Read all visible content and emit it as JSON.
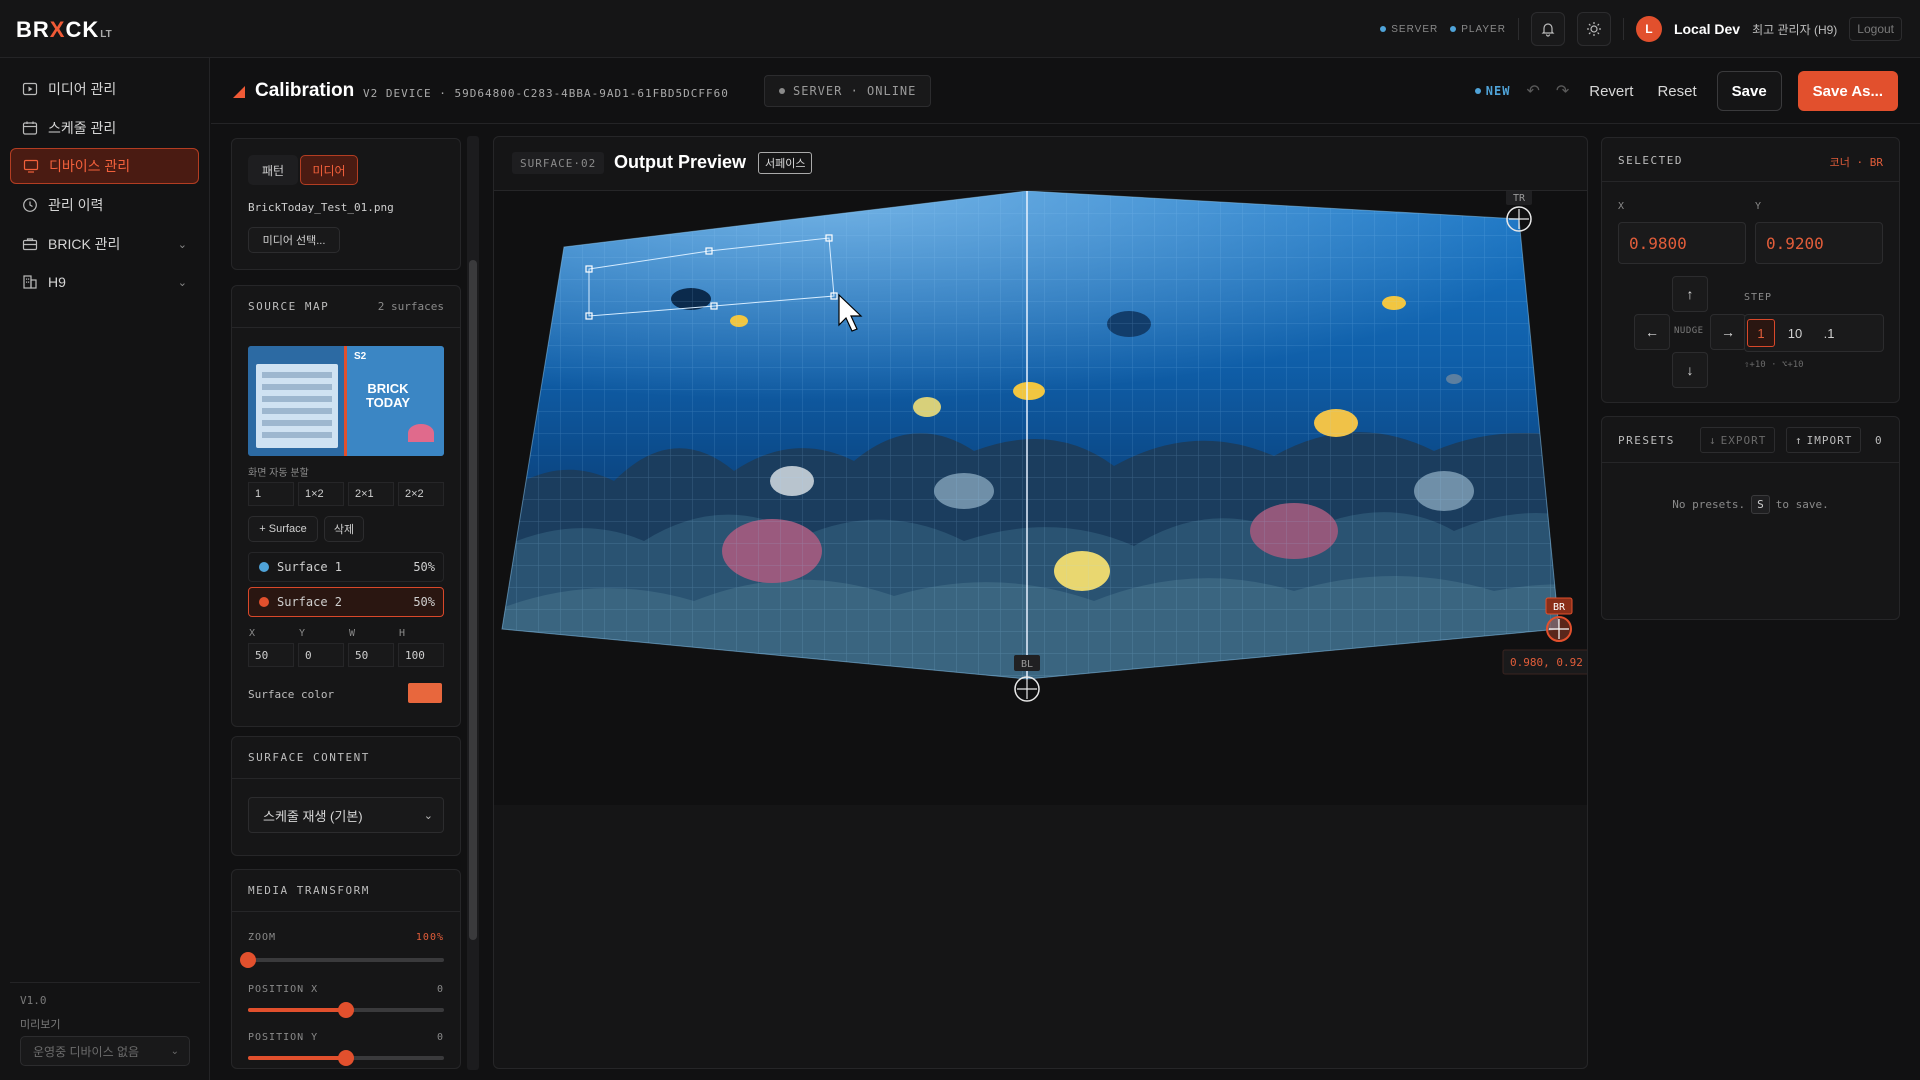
{
  "app": {
    "logo": {
      "pre": "BR",
      "mark": "X",
      "post": "CK",
      "sub": "LT"
    },
    "status": [
      {
        "label": "SERVER"
      },
      {
        "label": "PLAYER"
      }
    ],
    "user": {
      "initial": "L",
      "name": "Local Dev",
      "role": "최고 관리자 (H9)",
      "logout": "Logout"
    },
    "icons": {
      "bell": "bell-icon",
      "theme": "sun-icon"
    }
  },
  "sidebar": {
    "items": [
      {
        "label": "미디어 관리",
        "icon": "media-icon"
      },
      {
        "label": "스케줄 관리",
        "icon": "calendar-icon"
      },
      {
        "label": "디바이스 관리",
        "icon": "monitor-icon",
        "active": true
      },
      {
        "label": "관리 이력",
        "icon": "clock-icon"
      },
      {
        "label": "BRICK 관리",
        "icon": "briefcase-icon",
        "expandable": true
      },
      {
        "label": "H9",
        "icon": "building-icon",
        "expandable": true
      }
    ],
    "version": "V1.0",
    "preview_label": "미리보기",
    "device_select": "운영중 디바이스 없음"
  },
  "header": {
    "title": "Calibration",
    "device": "V2 DEVICE · 59D64800-C283-4BBA-9AD1-61FBD5DCFF60",
    "server_status": "SERVER · ONLINE",
    "new_badge": "NEW",
    "undo": "↶",
    "redo": "↷",
    "revert": "Revert",
    "reset": "Reset",
    "save": "Save",
    "save_as": "Save As..."
  },
  "media_panel": {
    "tabs": [
      "패턴",
      "미디어"
    ],
    "active_tab": "미디어",
    "file_name": "BrickToday_Test_01.png",
    "select_button": "미디어 선택..."
  },
  "source_map": {
    "title": "SOURCE MAP",
    "count": "2 surfaces",
    "thumb_label": "S2",
    "thumb_text": "BRICK TODAY",
    "split_label": "화면 자동 분할",
    "split_options": [
      "1",
      "1×2",
      "2×1",
      "2×2"
    ],
    "add_surface": "+ Surface",
    "delete": "삭제",
    "surfaces": [
      {
        "name": "Surface 1",
        "pct": "50%",
        "color": "#4fa3d8"
      },
      {
        "name": "Surface 2",
        "pct": "50%",
        "color": "#e2502d",
        "selected": true
      }
    ],
    "fields": {
      "labels": [
        "X",
        "Y",
        "W",
        "H"
      ],
      "values": [
        "50",
        "0",
        "50",
        "100"
      ]
    },
    "surface_color_label": "Surface color",
    "surface_color": "#e8673d"
  },
  "surface_content": {
    "title": "SURFACE CONTENT",
    "value": "스케줄 재생 (기본)"
  },
  "media_transform": {
    "title": "MEDIA TRANSFORM",
    "zoom": {
      "label": "ZOOM",
      "value": "100%",
      "fraction": 0
    },
    "position_x": {
      "label": "POSITION X",
      "value": "0",
      "fraction": 0.5
    },
    "position_y": {
      "label": "POSITION Y",
      "value": "0",
      "fraction": 0.5
    }
  },
  "preview": {
    "tag": "SURFACE·02",
    "title": "Output Preview",
    "chip": "서페이스",
    "corners": {
      "tr": "TR",
      "bl": "BL",
      "br": "BR"
    },
    "coord_readout": "0.980, 0.92"
  },
  "selected": {
    "title": "SELECTED",
    "corner": "코너 · BR",
    "x_label": "X",
    "y_label": "Y",
    "x_value": "0.9800",
    "y_value": "0.9200",
    "nudge": "NUDGE",
    "step_label": "STEP",
    "steps": [
      "1",
      "10",
      ".1"
    ],
    "active_step": "1",
    "hint": "⇧+10 · ⌥+10"
  },
  "presets": {
    "title": "PRESETS",
    "export": "EXPORT",
    "import": "IMPORT",
    "count": "0",
    "empty_pre": "No presets.",
    "empty_key": "S",
    "empty_post": "to save."
  }
}
